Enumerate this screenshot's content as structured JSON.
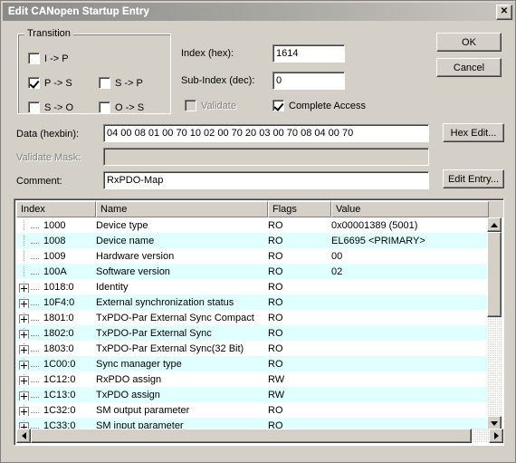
{
  "window": {
    "title": "Edit CANopen Startup Entry",
    "close_label": "✕"
  },
  "transition": {
    "legend": "Transition",
    "items": [
      {
        "label": "I -> P",
        "checked": false
      },
      {
        "label": "P -> S",
        "checked": true
      },
      {
        "label": "S -> P",
        "checked": false
      },
      {
        "label": "S -> O",
        "checked": false
      },
      {
        "label": "O -> S",
        "checked": false
      }
    ]
  },
  "fields": {
    "index_label": "Index (hex):",
    "index_value": "1614",
    "subindex_label": "Sub-Index (dec):",
    "subindex_value": "0",
    "validate_label": "Validate",
    "validate_checked": false,
    "complete_access_label": "Complete Access",
    "complete_access_checked": true,
    "data_label": "Data (hexbin):",
    "data_value": "04 00 08 01 00 70 10 02 00 70 20 03 00 70 08 04 00 70",
    "validate_mask_label": "Validate Mask:",
    "validate_mask_value": "",
    "comment_label": "Comment:",
    "comment_value": "RxPDO-Map"
  },
  "buttons": {
    "ok": "OK",
    "cancel": "Cancel",
    "hex_edit": "Hex Edit...",
    "edit_entry": "Edit Entry..."
  },
  "table": {
    "columns": [
      "Index",
      "Name",
      "Flags",
      "Value"
    ],
    "rows": [
      {
        "expandable": false,
        "index": "1000",
        "name": "Device type",
        "flags": "RO",
        "value": "0x00001389 (5001)"
      },
      {
        "expandable": false,
        "index": "1008",
        "name": "Device name",
        "flags": "RO",
        "value": "EL6695 <PRIMARY>"
      },
      {
        "expandable": false,
        "index": "1009",
        "name": "Hardware version",
        "flags": "RO",
        "value": "00"
      },
      {
        "expandable": false,
        "index": "100A",
        "name": "Software version",
        "flags": "RO",
        "value": "02"
      },
      {
        "expandable": true,
        "index": "1018:0",
        "name": "Identity",
        "flags": "RO",
        "value": ""
      },
      {
        "expandable": true,
        "index": "10F4:0",
        "name": "External synchronization status",
        "flags": "RO",
        "value": ""
      },
      {
        "expandable": true,
        "index": "1801:0",
        "name": "TxPDO-Par External Sync Compact",
        "flags": "RO",
        "value": ""
      },
      {
        "expandable": true,
        "index": "1802:0",
        "name": "TxPDO-Par External Sync",
        "flags": "RO",
        "value": ""
      },
      {
        "expandable": true,
        "index": "1803:0",
        "name": "TxPDO-Par External Sync(32 Bit)",
        "flags": "RO",
        "value": ""
      },
      {
        "expandable": true,
        "index": "1C00:0",
        "name": "Sync manager type",
        "flags": "RO",
        "value": ""
      },
      {
        "expandable": true,
        "index": "1C12:0",
        "name": "RxPDO assign",
        "flags": "RW",
        "value": ""
      },
      {
        "expandable": true,
        "index": "1C13:0",
        "name": "TxPDO assign",
        "flags": "RW",
        "value": ""
      },
      {
        "expandable": true,
        "index": "1C32:0",
        "name": "SM output parameter",
        "flags": "RO",
        "value": ""
      },
      {
        "expandable": true,
        "index": "1C33:0",
        "name": "SM input parameter",
        "flags": "RO",
        "value": ""
      }
    ]
  }
}
